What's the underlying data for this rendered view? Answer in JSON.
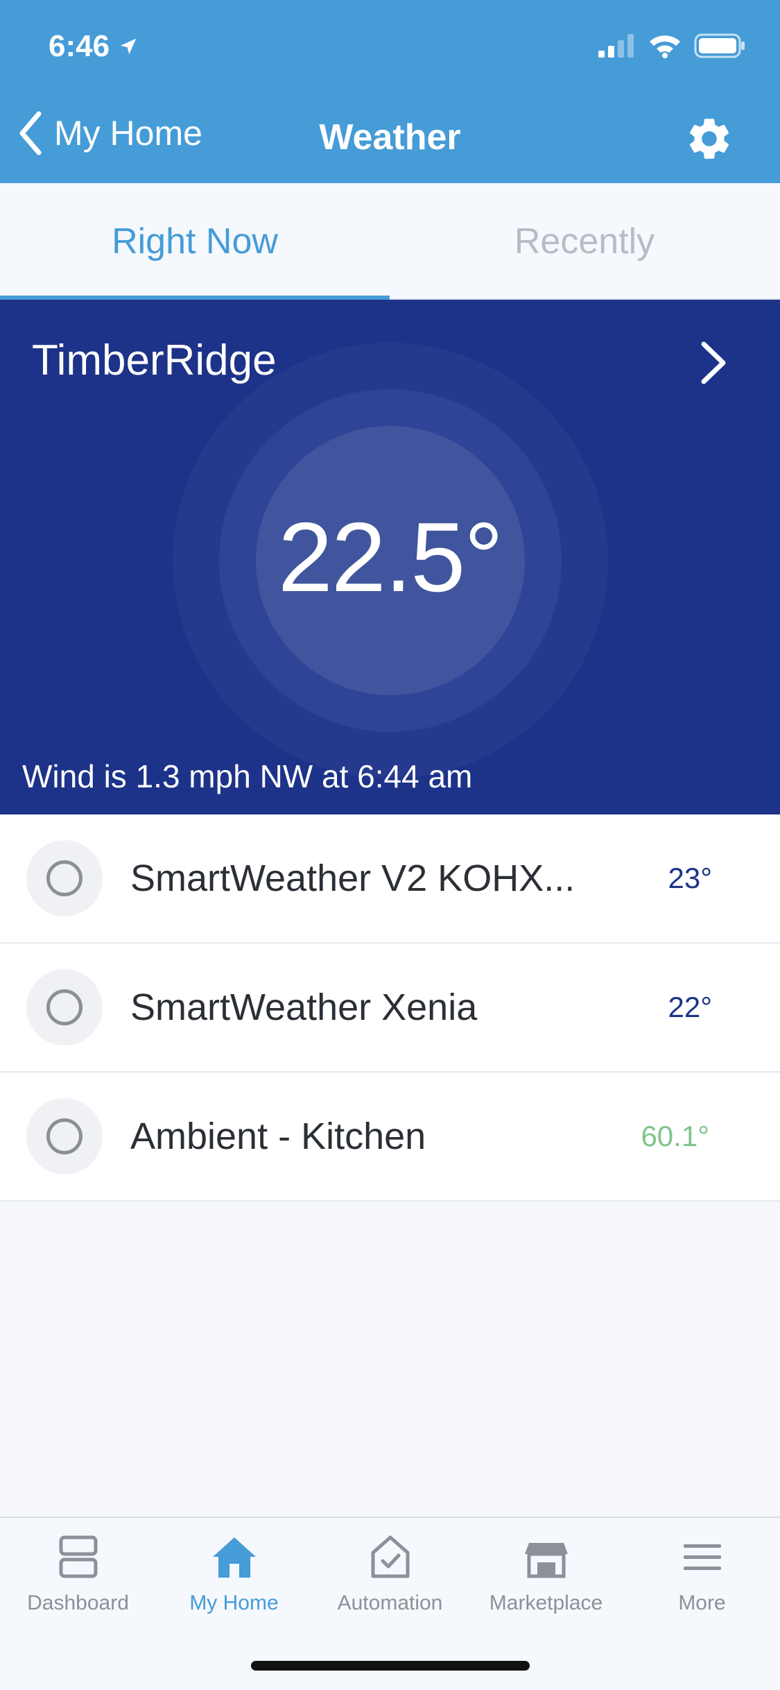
{
  "status_bar": {
    "time": "6:46"
  },
  "nav": {
    "back_label": "My Home",
    "title": "Weather"
  },
  "tabs": [
    {
      "label": "Right Now",
      "active": true
    },
    {
      "label": "Recently",
      "active": false
    }
  ],
  "hero": {
    "location": "TimberRidge",
    "temperature": "22.5°",
    "wind": "Wind is 1.3 mph NW at 6:44 am"
  },
  "devices": [
    {
      "name": "SmartWeather V2 KOHX...",
      "value": "23°",
      "color": "#1d3389"
    },
    {
      "name": "SmartWeather Xenia",
      "value": "22°",
      "color": "#1d3389"
    },
    {
      "name": "Ambient - Kitchen",
      "value": "60.1°",
      "color": "#7fc48c"
    }
  ],
  "tab_bar": {
    "items": [
      {
        "label": "Dashboard",
        "icon": "dashboard-icon",
        "active": false
      },
      {
        "label": "My Home",
        "icon": "home-icon",
        "active": true
      },
      {
        "label": "Automation",
        "icon": "automation-icon",
        "active": false
      },
      {
        "label": "Marketplace",
        "icon": "marketplace-icon",
        "active": false
      },
      {
        "label": "More",
        "icon": "menu-icon",
        "active": false
      }
    ]
  },
  "colors": {
    "accent": "#459cd7",
    "hero_bg": "#1d3389"
  }
}
